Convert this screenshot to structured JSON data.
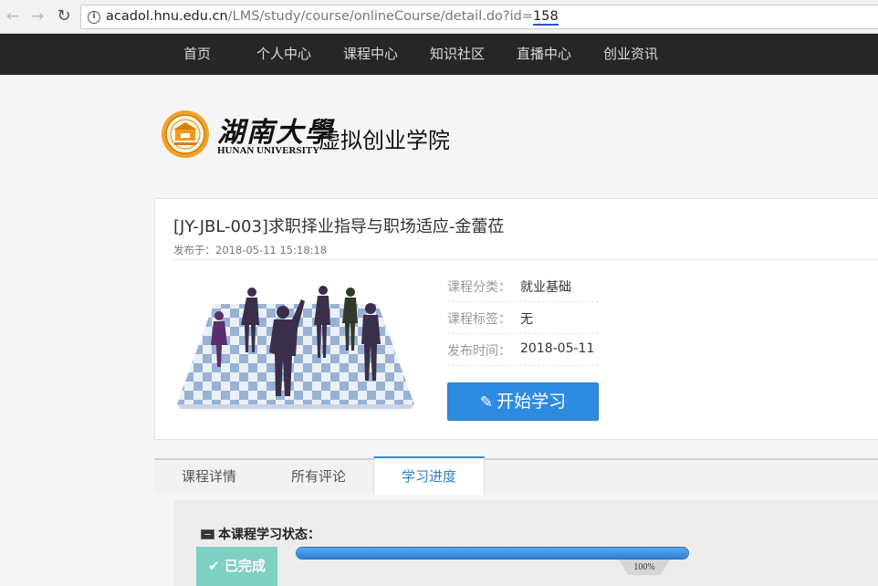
{
  "browser": {
    "url_prefix": "acadol.hnu.edu.cn",
    "url_path": "/LMS/study/course/onlineCourse/detail.do?id=",
    "url_id": "158"
  },
  "nav": {
    "items": [
      "首页",
      "个人中心",
      "课程中心",
      "知识社区",
      "直播中心",
      "创业资讯"
    ]
  },
  "logo": {
    "university_cn": "湖南大學",
    "university_en": "HUNAN UNIVERSITY",
    "school": "虚拟创业学院"
  },
  "course": {
    "title": "[JY-JBL-003]求职择业指导与职场适应-金蕾莅",
    "publish_label": "发布于：",
    "publish_time": "2018-05-11 15:18:18",
    "meta": [
      {
        "key": "课程分类：",
        "value": "就业基础"
      },
      {
        "key": "课程标签：",
        "value": "无"
      },
      {
        "key": "发布时间：",
        "value": "2018-05-11"
      }
    ],
    "start_button": "开始学习"
  },
  "tabs": [
    "课程详情",
    "所有评论",
    "学习进度"
  ],
  "active_tab": "学习进度",
  "progress": {
    "status_title": "本课程学习状态：",
    "badge": "已完成",
    "percent": 100,
    "percent_label": "100%"
  },
  "colors": {
    "nav_bg": "#262626",
    "accent": "#2f8be0",
    "badge_bg": "#7ed0c2"
  }
}
